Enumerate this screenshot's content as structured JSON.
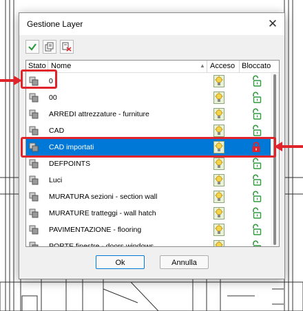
{
  "dialog": {
    "title": "Gestione Layer",
    "close_glyph": "✕"
  },
  "toolbar": {
    "icons": [
      "checkmark-icon",
      "new-layer-icon",
      "delete-layer-icon"
    ],
    "check_color": "#2e9a3e"
  },
  "columns": {
    "state": "Stato",
    "name": "Nome",
    "on": "Acceso",
    "locked": "Bloccato"
  },
  "layers": [
    {
      "name": "0",
      "locked": false,
      "selected": false
    },
    {
      "name": "00",
      "locked": false,
      "selected": false
    },
    {
      "name": "ARREDI attrezzature - furniture",
      "locked": false,
      "selected": false
    },
    {
      "name": "CAD",
      "locked": false,
      "selected": false
    },
    {
      "name": "CAD importati",
      "locked": true,
      "selected": true
    },
    {
      "name": "DEFPOINTS",
      "locked": false,
      "selected": false
    },
    {
      "name": "Luci",
      "locked": false,
      "selected": false
    },
    {
      "name": "MURATURA sezioni - section wall",
      "locked": false,
      "selected": false
    },
    {
      "name": "MURATURE tratteggi - wall hatch",
      "locked": false,
      "selected": false
    },
    {
      "name": "PAVIMENTAZIONE - flooring",
      "locked": false,
      "selected": false
    },
    {
      "name": "PORTE finestre - doors windows",
      "locked": false,
      "selected": false
    }
  ],
  "buttons": {
    "ok": "Ok",
    "cancel": "Annulla"
  },
  "colors": {
    "selection": "#0078d7",
    "annotation": "#e0242b",
    "lock_open": "#2e9a3e",
    "lock_closed": "#e0242b"
  }
}
